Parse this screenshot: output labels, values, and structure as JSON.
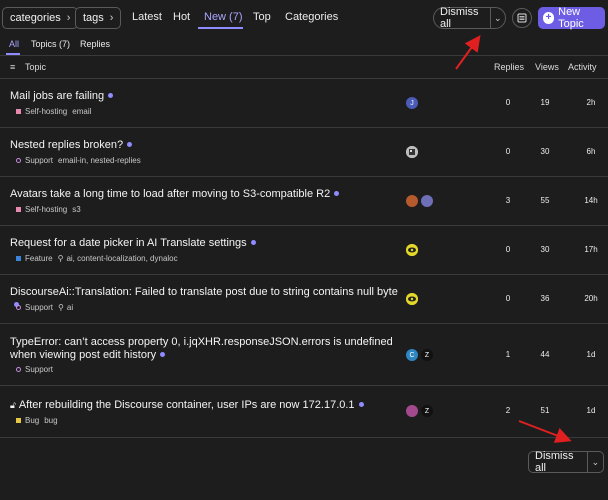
{
  "header": {
    "categories_label": "categories",
    "tags_label": "tags",
    "nav": [
      {
        "label": "Latest"
      },
      {
        "label": "Hot"
      },
      {
        "label": "New (7)"
      },
      {
        "label": "Top"
      },
      {
        "label": "Categories"
      }
    ],
    "dismiss_label": "Dismiss all",
    "new_topic_label": "New Topic"
  },
  "subtabs": [
    {
      "label": "All"
    },
    {
      "label": "Topics (7)"
    },
    {
      "label": "Replies"
    }
  ],
  "columns": {
    "topic": "Topic",
    "replies": "Replies",
    "views": "Views",
    "activity": "Activity"
  },
  "topics": [
    {
      "title": "Mail jobs are failing",
      "category": "Self-hosting",
      "cat_color": "#e88ab0",
      "tags": "email",
      "replies": "0",
      "views": "19",
      "activity": "2h",
      "avatars": [
        "J"
      ]
    },
    {
      "title": "Nested replies broken?",
      "category": "Support",
      "cat_color": "#c58fe0",
      "tags": "email-in, nested-replies",
      "replies": "0",
      "views": "30",
      "activity": "6h",
      "avatars": [
        ""
      ]
    },
    {
      "title": "Avatars take a long time to load after moving to S3-compatible R2",
      "category": "Self-hosting",
      "cat_color": "#e88ab0",
      "tags": "s3",
      "replies": "3",
      "views": "55",
      "activity": "14h",
      "avatars": [
        "",
        ""
      ]
    },
    {
      "title": "Request for a date picker in AI Translate settings",
      "category": "Feature",
      "cat_color": "#3b84d9",
      "tags": "ai, content-localization, dynaloc",
      "replies": "0",
      "views": "30",
      "activity": "17h",
      "avatars": [
        ""
      ]
    },
    {
      "title": "DiscourseAi::Translation: Failed to translate post due to string contains null byte",
      "category": "Support",
      "cat_color": "#c58fe0",
      "tags": "ai",
      "replies": "0",
      "views": "36",
      "activity": "20h",
      "avatars": [
        ""
      ]
    },
    {
      "title": "TypeError: can’t access property 0, i.jqXHR.responseJSON.errors is undefined when viewing post edit history",
      "category": "Support",
      "cat_color": "#c58fe0",
      "tags": "",
      "replies": "1",
      "views": "44",
      "activity": "1d",
      "avatars": [
        "C",
        "Z"
      ]
    },
    {
      "title": "After rebuilding the Discourse container, user IPs are now 172.17.0.1",
      "category": "Bug",
      "cat_color": "#e7c547",
      "tags": "bug",
      "replies": "2",
      "views": "51",
      "activity": "1d",
      "avatars": [
        "",
        "Z"
      ]
    }
  ],
  "footer": {
    "dismiss_label": "Dismiss all"
  }
}
